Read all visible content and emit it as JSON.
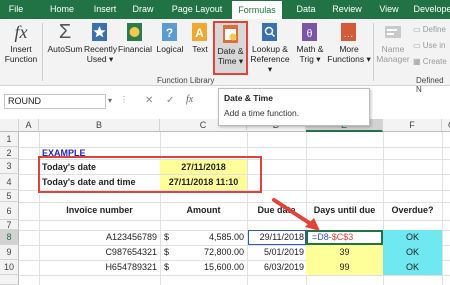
{
  "tabs": [
    "File",
    "Home",
    "Insert",
    "Draw",
    "Page Layout",
    "Formulas",
    "Data",
    "Review",
    "View",
    "Developer"
  ],
  "active_tab": "Formulas",
  "ribbon": {
    "insert_function": [
      "Insert",
      "Function"
    ],
    "autosum": [
      "AutoSum"
    ],
    "recently_used": [
      "Recently",
      "Used ▾"
    ],
    "financial": [
      "Financial"
    ],
    "logical": [
      "Logical"
    ],
    "text": [
      "Text"
    ],
    "date_time": [
      "Date &",
      "Time ▾"
    ],
    "lookup_reference": [
      "Lookup &",
      "Reference ▾"
    ],
    "math_trig": [
      "Math &",
      "Trig ▾"
    ],
    "more_functions": [
      "More",
      "Functions ▾"
    ],
    "name_manager": [
      "Name",
      "Manager"
    ],
    "define_name": "Define",
    "use_in_formula": "Use in",
    "create_from_selection": "Create",
    "group_function_library": "Function Library",
    "group_defined_names": "Defined N"
  },
  "name_box": "ROUND",
  "formula_bar_icons": {
    "cancel": "✕",
    "enter": "✓",
    "fx": "fx"
  },
  "tooltip": {
    "title": "Date & Time",
    "desc": "Add a time function."
  },
  "columns": [
    "A",
    "B",
    "C",
    "D",
    "E",
    "F",
    "G"
  ],
  "rows": [
    "1",
    "2",
    "3",
    "4",
    "5",
    "6",
    "7",
    "8",
    "9",
    "10"
  ],
  "sheet": {
    "example_label": "EXAMPLE",
    "todays_date_label": "Today's date",
    "todays_date_value": "27/11/2018",
    "todays_datetime_label": "Today's date and time",
    "todays_datetime_value": "27/11/2018 11:10",
    "headers": {
      "invoice": "Invoice number",
      "amount": "Amount",
      "due_date": "Due date",
      "days_until_due": "Days until due",
      "overdue": "Overdue?"
    },
    "data_rows": [
      {
        "invoice": "A123456789",
        "currency": "$",
        "amount": "4,585.00",
        "due_date": "29/11/2018",
        "days_formula_part1": "=D8-",
        "days_formula_part2": "$C$3",
        "overdue": "OK"
      },
      {
        "invoice": "C987654321",
        "currency": "$",
        "amount": "72,800.00",
        "due_date": "5/01/2019",
        "days": "39",
        "overdue": "OK"
      },
      {
        "invoice": "H654789321",
        "currency": "$",
        "amount": "15,600.00",
        "due_date": "6/03/2019",
        "days": "99",
        "overdue": "OK"
      }
    ]
  },
  "colors": {
    "excel_green": "#217346",
    "highlight_red": "#e0433a",
    "yellow_cell": "#ffff99",
    "cyan_cell": "#6fe8f2",
    "blue_text": "#2323c8",
    "formula_red": "#e0433a"
  }
}
